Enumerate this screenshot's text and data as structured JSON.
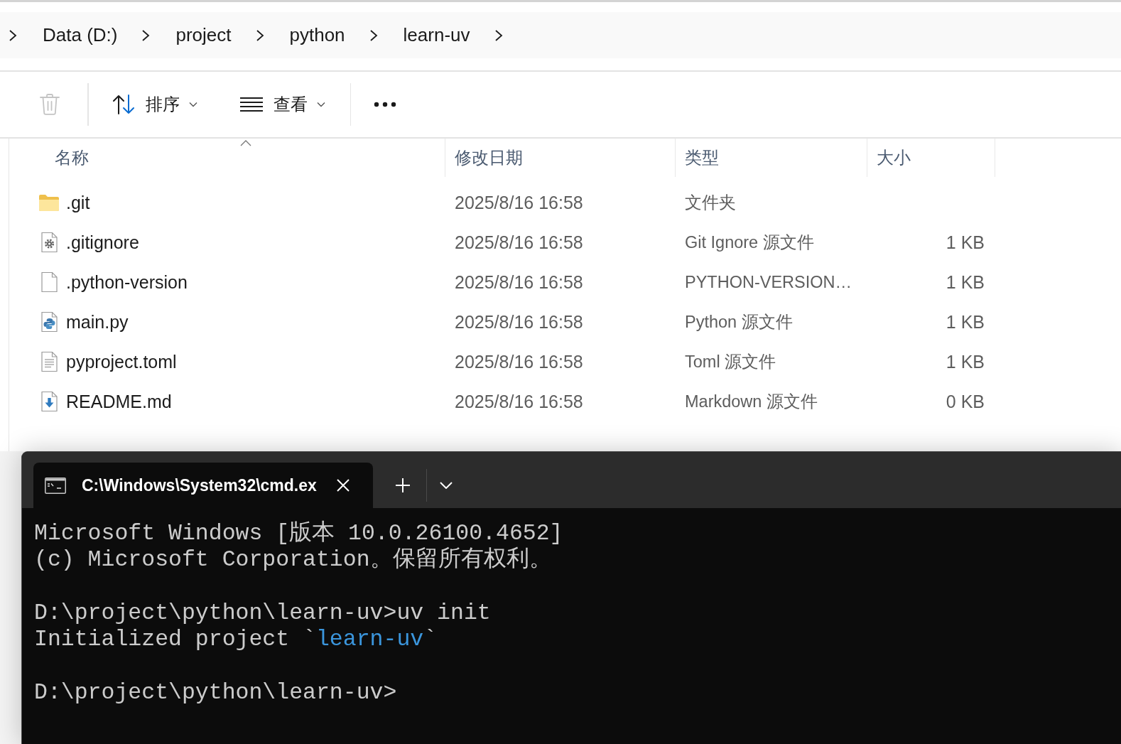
{
  "address_bar": {
    "items": [
      "Data (D:)",
      "project",
      "python",
      "learn-uv"
    ]
  },
  "toolbar": {
    "groups": [
      [
        {
          "kind": "delete",
          "disabled": true
        }
      ],
      [
        {
          "kind": "sort",
          "label": "排序",
          "disabled": false
        },
        {
          "kind": "view",
          "label": "查看",
          "disabled": false
        }
      ],
      [
        {
          "kind": "more",
          "disabled": false
        }
      ]
    ]
  },
  "file_list": {
    "columns": [
      {
        "label": "名称",
        "sorted": true
      },
      {
        "label": "修改日期",
        "sorted": false
      },
      {
        "label": "类型",
        "sorted": false
      },
      {
        "label": "大小",
        "sorted": false
      }
    ],
    "rows": [
      {
        "kind": "folder",
        "name": ".git",
        "modified": "2025/8/16 16:58",
        "type": "文件夹",
        "selected": false
      },
      {
        "kind": "settings",
        "name": ".gitignore",
        "modified": "2025/8/16 16:58",
        "type": "Git Ignore 源文件",
        "size": "1 KB",
        "selected": false
      },
      {
        "kind": "blank",
        "name": ".python-version",
        "modified": "2025/8/16 16:58",
        "type": "PYTHON-VERSION…",
        "size": "1 KB",
        "selected": false
      },
      {
        "kind": "python",
        "name": "main.py",
        "modified": "2025/8/16 16:58",
        "type": "Python 源文件",
        "size": "1 KB",
        "selected": false
      },
      {
        "kind": "text",
        "name": "pyproject.toml",
        "modified": "2025/8/16 16:58",
        "type": "Toml 源文件",
        "size": "1 KB",
        "selected": false
      },
      {
        "kind": "download",
        "name": "README.md",
        "modified": "2025/8/16 16:58",
        "type": "Markdown 源文件",
        "size": "0 KB",
        "selected": false
      }
    ]
  },
  "terminal": {
    "tabs": [
      {
        "title": "C:\\Windows\\System32\\cmd.ex",
        "selected": true
      }
    ],
    "blocks": [
      [
        [
          {
            "kind": "plain",
            "text": "Microsoft Windows [版本 10.0.26100.4652]"
          }
        ],
        [
          {
            "kind": "plain",
            "text": "(c) Microsoft Corporation。保留所有权利。"
          }
        ]
      ],
      [
        [
          {
            "kind": "plain",
            "text": "D:\\project\\python\\learn-uv>uv init"
          }
        ],
        [
          {
            "kind": "plain",
            "text": "Initialized project `"
          },
          {
            "kind": "highlight",
            "text": "learn-uv"
          },
          {
            "kind": "plain",
            "text": "`"
          }
        ]
      ],
      [
        [
          {
            "kind": "plain",
            "text": "D:\\project\\python\\learn-uv>"
          }
        ]
      ]
    ]
  }
}
